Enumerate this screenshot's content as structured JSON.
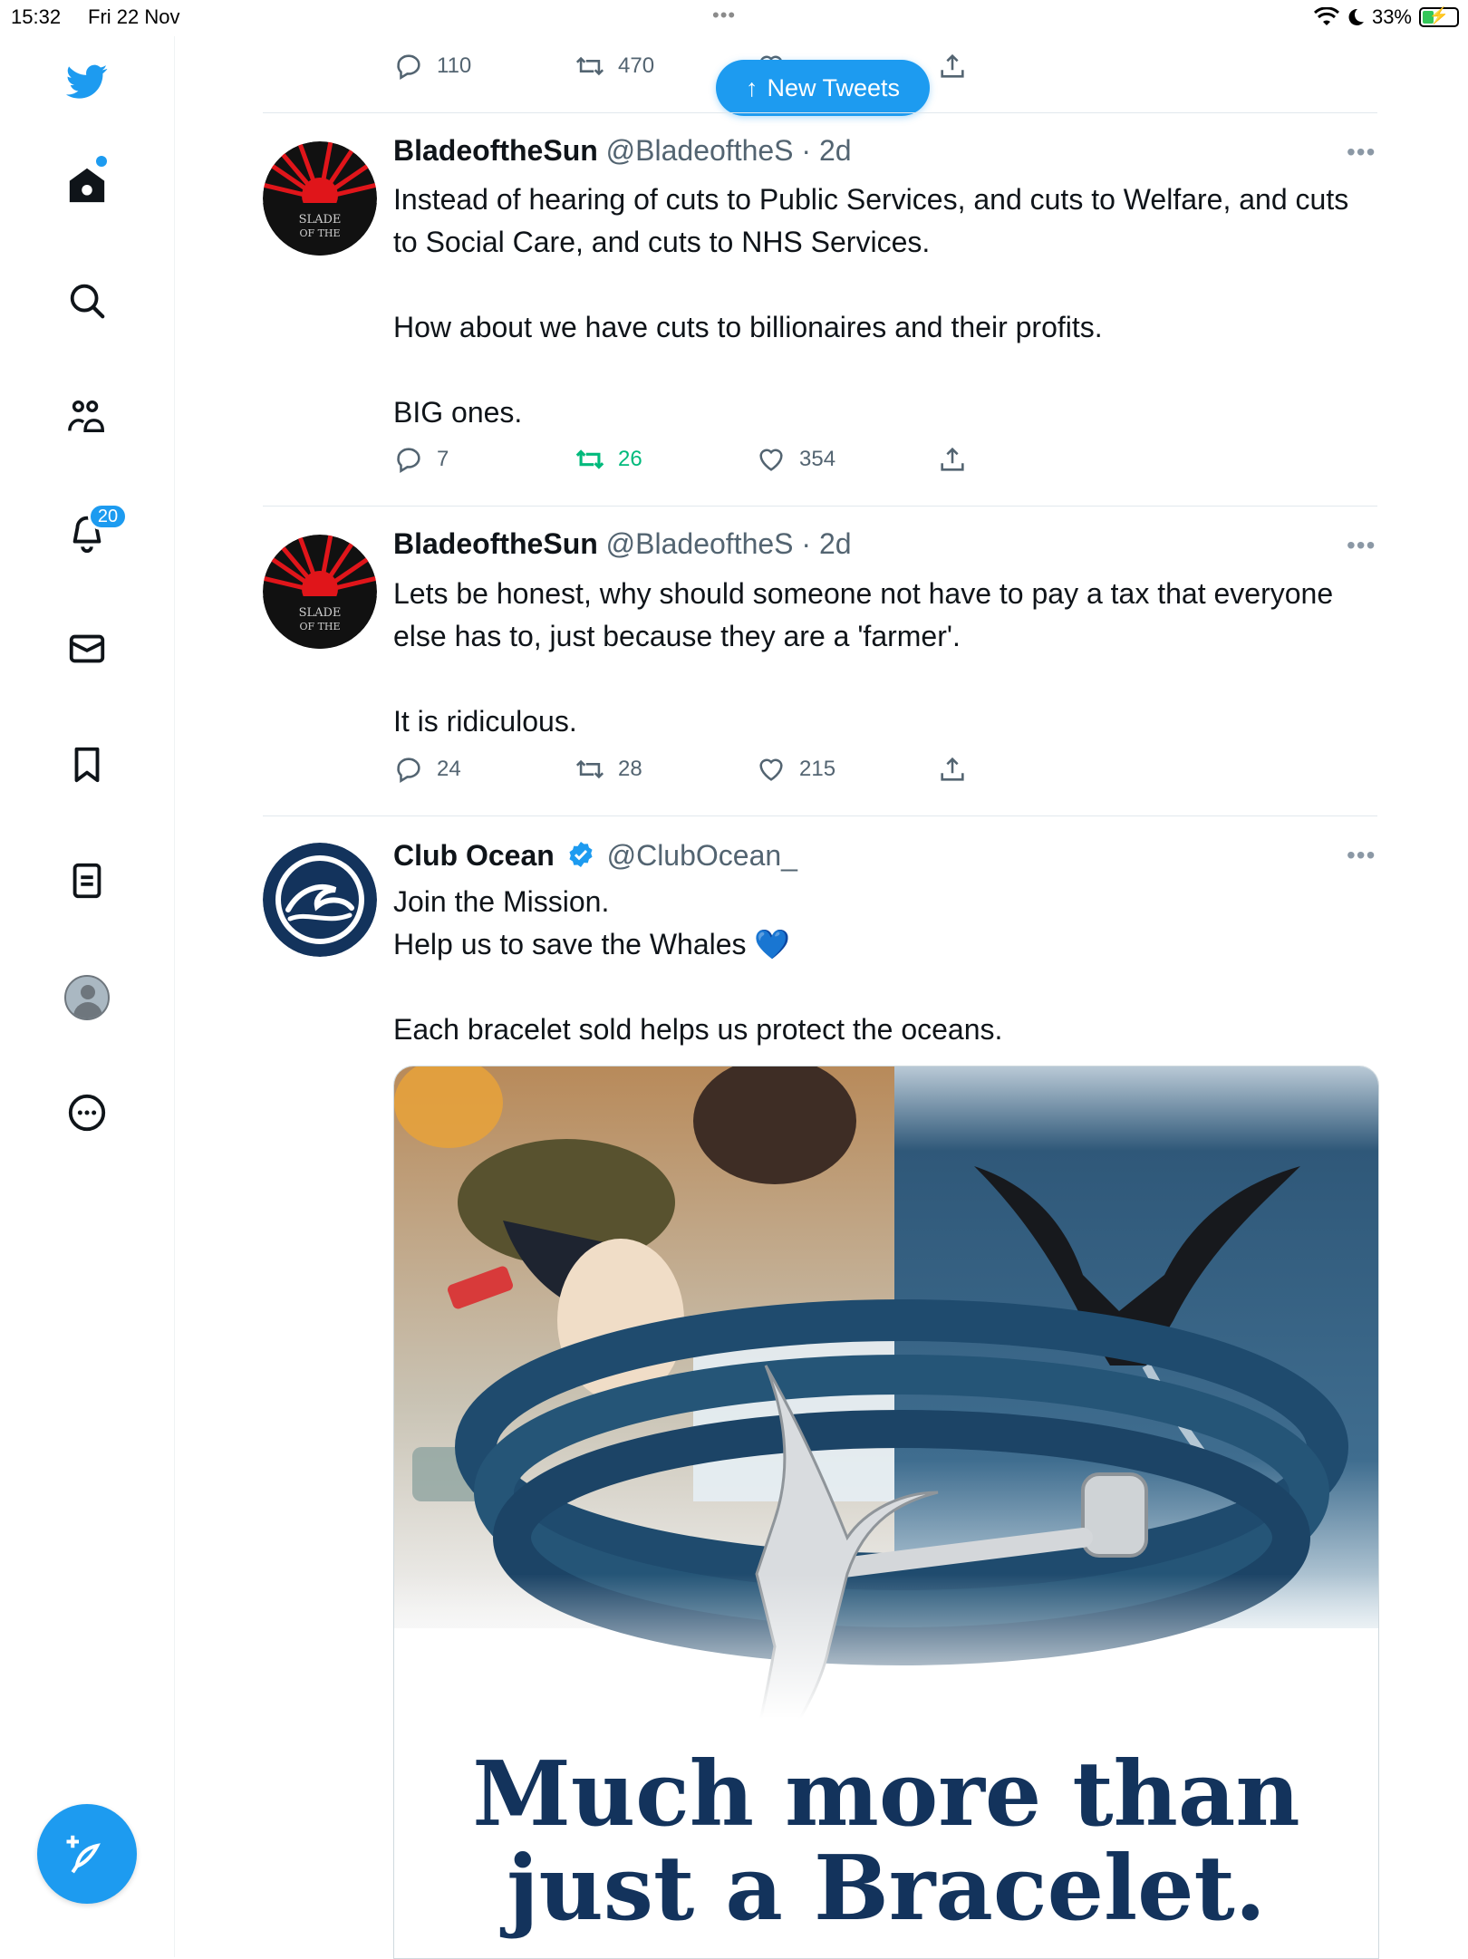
{
  "status_bar": {
    "time": "15:32",
    "date": "Fri 22 Nov",
    "battery_percent": "33%",
    "battery_level": 0.33
  },
  "sidebar": {
    "notifications_badge": "20",
    "items": [
      "twitter-logo",
      "home",
      "search",
      "communities",
      "notifications",
      "messages",
      "bookmarks",
      "lists",
      "profile",
      "more"
    ]
  },
  "new_tweets_label": "New Tweets",
  "top_partial": {
    "replies": "110",
    "retweets": "470"
  },
  "tweets": [
    {
      "name": "BladeoftheSun",
      "handle": "@BladeoftheS",
      "time": "· 2d",
      "text": "Instead of hearing of cuts to Public Services, and cuts to Welfare, and cuts to Social Care, and cuts to NHS Services.\n\nHow about we have cuts to billionaires and their profits.\n\nBIG ones.",
      "replies": "7",
      "retweets": "26",
      "likes": "354",
      "avatar_text": "BLADE OF THE SUN"
    },
    {
      "name": "BladeoftheSun",
      "handle": "@BladeoftheS",
      "time": "· 2d",
      "text": "Lets be honest, why should someone not have to pay a tax that everyone else has to, just because they are a 'farmer'.\n\nIt is ridiculous.",
      "replies": "24",
      "retweets": "28",
      "likes": "215",
      "avatar_text": "BLADE OF THE SUN"
    },
    {
      "name": "Club Ocean",
      "handle": "@ClubOcean_",
      "text": "Join the Mission.\nHelp us to save the Whales 💙\n\nEach bracelet sold helps us protect the oceans.",
      "media_tagline_1": "Much more than",
      "media_tagline_2": "just a Bracelet."
    }
  ],
  "colors": {
    "accent": "#1d9bf0",
    "retweet_active": "#00ba7c",
    "muted": "#536471",
    "tagline": "#13335c"
  }
}
